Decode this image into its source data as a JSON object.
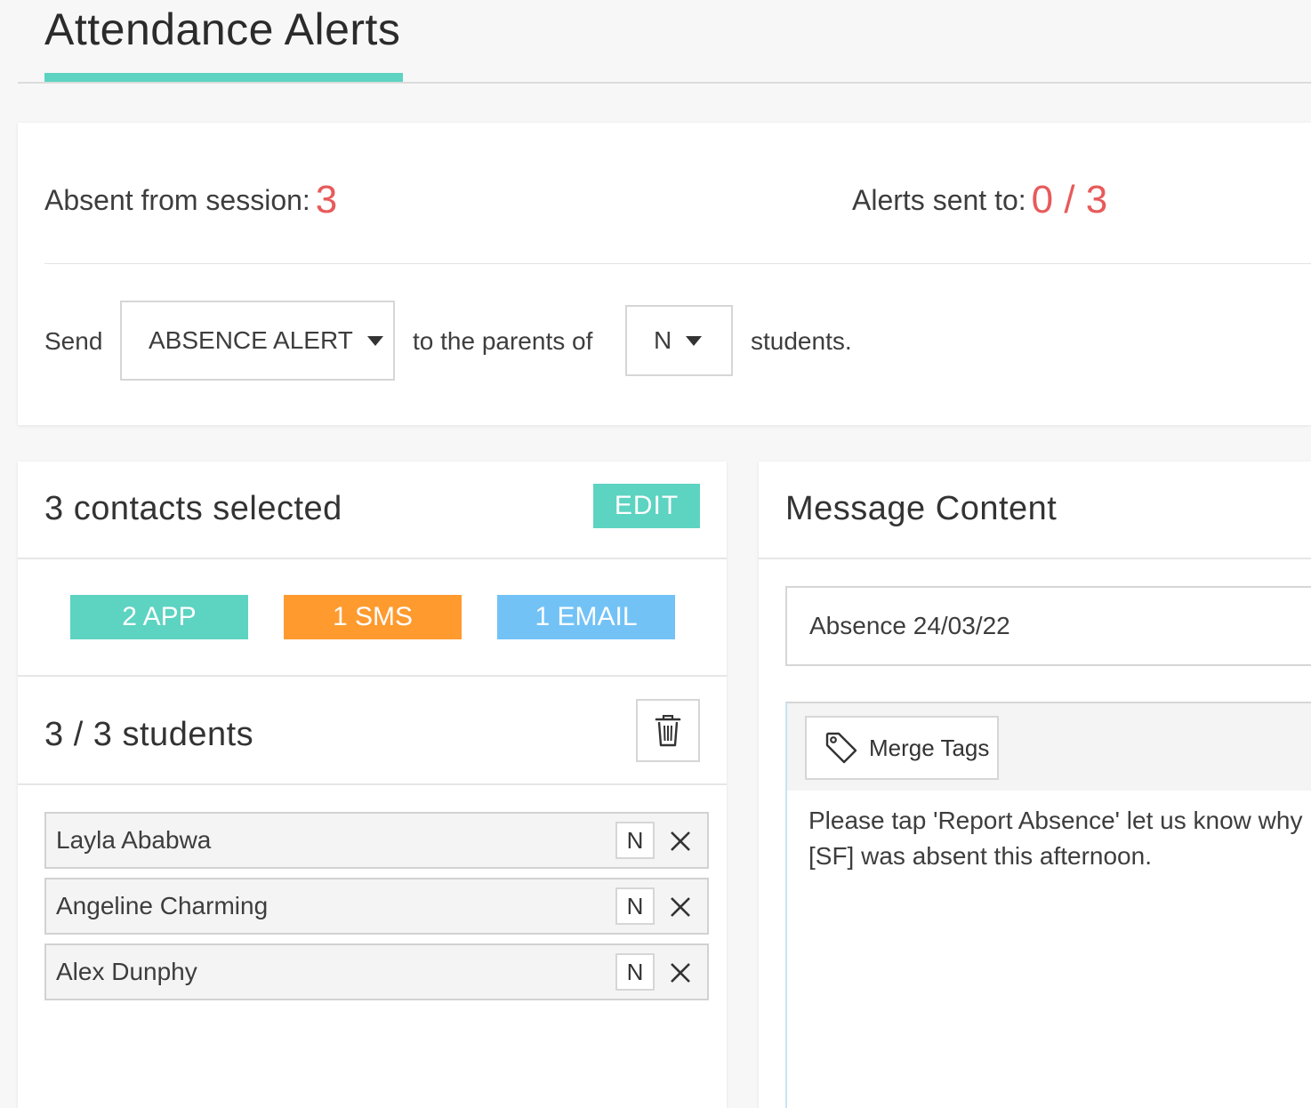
{
  "header": {
    "title": "Attendance Alerts"
  },
  "colors": {
    "accent": "#5dd3c1",
    "alert_number": "#e85a5a",
    "app": "#5dd3c1",
    "sms": "#fe9a2e",
    "email": "#72c2f6"
  },
  "summary": {
    "absent_label": "Absent from session:",
    "absent_count": "3",
    "alerts_label": "Alerts sent to:",
    "alerts_count": "0 / 3",
    "send_label": "Send",
    "alert_type": "ABSENCE ALERT",
    "middle_label": "to the parents of",
    "filter_value": "N",
    "end_label": "students."
  },
  "contacts": {
    "heading": "3 contacts selected",
    "edit_label": "EDIT",
    "app_label": "2 APP",
    "sms_label": "1 SMS",
    "email_label": "1 EMAIL",
    "students_heading": "3 / 3 students",
    "students": [
      {
        "name": "Layla Ababwa",
        "status": "N"
      },
      {
        "name": "Angeline Charming",
        "status": "N"
      },
      {
        "name": "Alex Dunphy",
        "status": "N"
      }
    ]
  },
  "message": {
    "heading": "Message Content",
    "subject": "Absence 24/03/22",
    "merge_tags_label": "Merge Tags",
    "body": "Please tap 'Report Absence' let us know why [SF] was absent this afternoon."
  },
  "icons": {
    "trash": "trash-icon",
    "remove": "close-icon",
    "tag": "tag-icon",
    "caret": "caret-down-icon"
  }
}
